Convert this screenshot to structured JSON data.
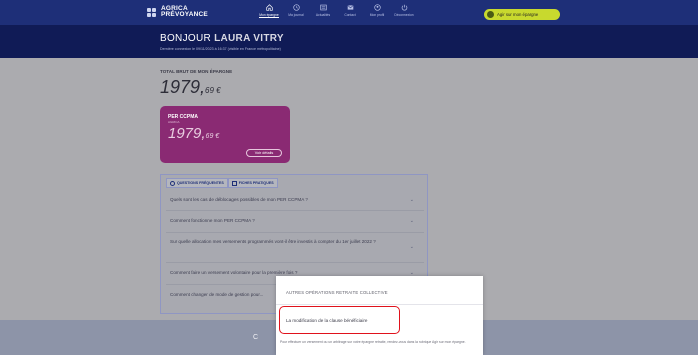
{
  "header": {
    "logo_line1": "AGRICA",
    "logo_line2": "PRÉVOYANCE",
    "nav": [
      {
        "label": "Mon épargne",
        "icon": "home-icon",
        "active": true
      },
      {
        "label": "Ma journal",
        "icon": "clock-icon",
        "active": false
      },
      {
        "label": "Actualités",
        "icon": "news-icon",
        "active": false
      },
      {
        "label": "Contact",
        "icon": "mail-icon",
        "active": false
      },
      {
        "label": "Mon profil",
        "icon": "profile-icon",
        "active": false
      },
      {
        "label": "Déconnexion",
        "icon": "power-icon",
        "active": false
      }
    ],
    "cta_label": "Agir sur mon épargne"
  },
  "hero": {
    "greeting": "BONJOUR",
    "name": "LAURA VITRY",
    "last_login": "Dernière connexion le 09/11/2023 à 16:37 (visible en France métropolitaine)"
  },
  "savings": {
    "total_label": "TOTAL BRUT DE MON ÉPARGNE",
    "total_int": "1979,",
    "total_dec": "69 €"
  },
  "card": {
    "title": "PER CCPMA",
    "subtitle": "AGRICA",
    "amount_int": "1979,",
    "amount_dec": "69 €",
    "button": "Voir détails"
  },
  "faq": {
    "tabs": [
      {
        "label": "QUESTIONS FRÉQUENTES",
        "icon": "question-icon"
      },
      {
        "label": "FICHES PRATIQUES",
        "icon": "document-icon"
      }
    ],
    "questions": [
      "Quels sont les cas de déblocages possibles de mon PER CCPMA ?",
      "Comment fonctionne mon PER CCPMA ?",
      "Sur quelle allocation mes versements programmés vont-il être investis à compter du 1er juillet 2022 ?",
      "Comment faire un versement volontaire pour la première fois ?",
      "Comment changer de mode de gestion pour..."
    ]
  },
  "footer": {
    "text": "C"
  },
  "popup": {
    "title": "AUTRES OPÉRATIONS RETRAITE COLLECTIVE",
    "item": "La modification de la clause bénéficiaire",
    "note": "Pour effectuer un versement ou un arbitrage sur votre épargne retraite, rendez-vous dans la rubrique Agir sur mon épargne."
  },
  "colors": {
    "nav_bg": "#1e2f78",
    "cta": "#c8d92e",
    "card": "#8a2a73",
    "highlight": "#e0121c"
  }
}
